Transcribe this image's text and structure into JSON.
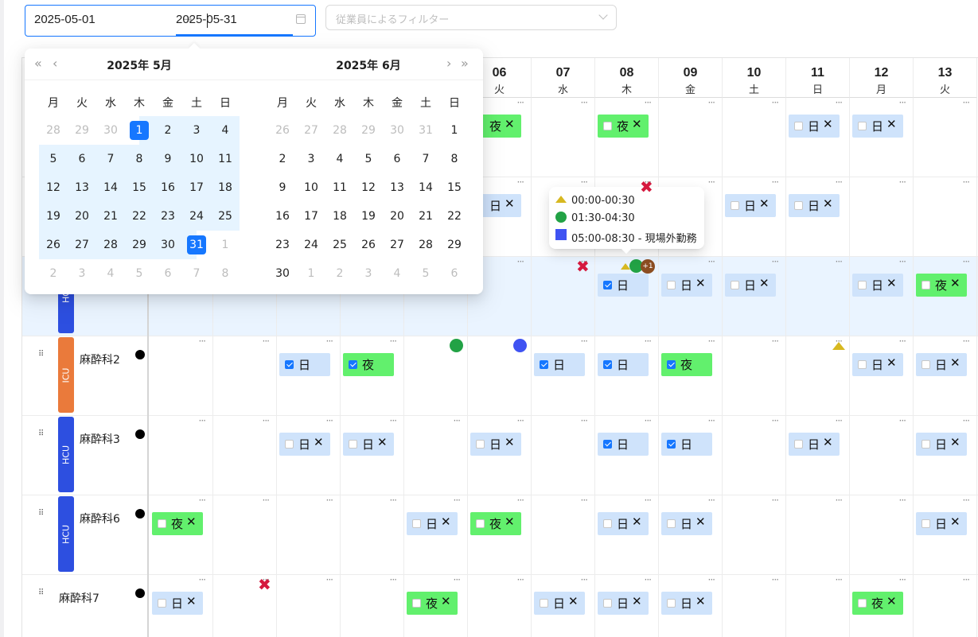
{
  "range_picker": {
    "start": "2025-05-01",
    "end": "2025-05-31",
    "separator": "→"
  },
  "filter": {
    "placeholder": "従業員によるフィルター"
  },
  "schedule": {
    "days": [
      {
        "day": "06",
        "wd": "火"
      },
      {
        "day": "07",
        "wd": "水"
      },
      {
        "day": "08",
        "wd": "木"
      },
      {
        "day": "09",
        "wd": "金"
      },
      {
        "day": "10",
        "wd": "土"
      },
      {
        "day": "11",
        "wd": "日"
      },
      {
        "day": "12",
        "wd": "月"
      },
      {
        "day": "13",
        "wd": "火"
      }
    ],
    "rows": [
      {
        "unit": "HCU",
        "name": "",
        "hl": true
      },
      {
        "unit": "ICU",
        "name": "麻酔科2"
      },
      {
        "unit": "HCU",
        "name": "麻酔科3"
      },
      {
        "unit": "HCU",
        "name": "麻酔科6"
      },
      {
        "unit": "",
        "name": "麻酔科7"
      }
    ],
    "chips": [
      {
        "row": -2,
        "col": 5,
        "t": "夜",
        "k": "n",
        "x": true
      },
      {
        "row": -2,
        "col": 7,
        "t": "夜",
        "k": "n",
        "x": true,
        "cb": "off"
      },
      {
        "row": -2,
        "col": 10,
        "t": "日",
        "k": "d",
        "x": true,
        "cb": "off"
      },
      {
        "row": -2,
        "col": 11,
        "t": "日",
        "k": "d",
        "x": true,
        "cb": "off"
      },
      {
        "row": -1,
        "col": 5,
        "t": "日",
        "k": "d",
        "x": true
      },
      {
        "row": -1,
        "col": 9,
        "t": "日",
        "k": "d",
        "x": true,
        "cb": "off"
      },
      {
        "row": -1,
        "col": 10,
        "t": "日",
        "k": "d",
        "x": true,
        "cb": "off"
      },
      {
        "row": 0,
        "col": 7,
        "t": "日",
        "k": "d",
        "x": false,
        "cb": "on"
      },
      {
        "row": 0,
        "col": 8,
        "t": "日",
        "k": "d",
        "x": true,
        "cb": "off"
      },
      {
        "row": 0,
        "col": 9,
        "t": "日",
        "k": "d",
        "x": true,
        "cb": "off"
      },
      {
        "row": 0,
        "col": 11,
        "t": "日",
        "k": "d",
        "x": true,
        "cb": "off"
      },
      {
        "row": 0,
        "col": 12,
        "t": "夜",
        "k": "n",
        "x": true,
        "cb": "off"
      },
      {
        "row": 1,
        "col": 2,
        "t": "日",
        "k": "d",
        "x": false,
        "cb": "on"
      },
      {
        "row": 1,
        "col": 3,
        "t": "夜",
        "k": "n",
        "x": false,
        "cb": "on"
      },
      {
        "row": 1,
        "col": 6,
        "t": "日",
        "k": "d",
        "x": false,
        "cb": "on"
      },
      {
        "row": 1,
        "col": 7,
        "t": "日",
        "k": "d",
        "x": false,
        "cb": "on"
      },
      {
        "row": 1,
        "col": 8,
        "t": "夜",
        "k": "n",
        "x": false,
        "cb": "on"
      },
      {
        "row": 1,
        "col": 11,
        "t": "日",
        "k": "d",
        "x": true,
        "cb": "off"
      },
      {
        "row": 1,
        "col": 12,
        "t": "日",
        "k": "d",
        "x": true,
        "cb": "off"
      },
      {
        "row": 2,
        "col": 2,
        "t": "日",
        "k": "d",
        "x": true,
        "cb": "off"
      },
      {
        "row": 2,
        "col": 3,
        "t": "日",
        "k": "d",
        "x": true,
        "cb": "off"
      },
      {
        "row": 2,
        "col": 5,
        "t": "日",
        "k": "d",
        "x": true,
        "cb": "off"
      },
      {
        "row": 2,
        "col": 7,
        "t": "日",
        "k": "d",
        "x": false,
        "cb": "on"
      },
      {
        "row": 2,
        "col": 8,
        "t": "日",
        "k": "d",
        "x": false,
        "cb": "on"
      },
      {
        "row": 2,
        "col": 10,
        "t": "日",
        "k": "d",
        "x": true,
        "cb": "off"
      },
      {
        "row": 2,
        "col": 12,
        "t": "日",
        "k": "d",
        "x": true,
        "cb": "off"
      },
      {
        "row": 3,
        "col": 0,
        "t": "夜",
        "k": "n",
        "x": true,
        "cb": "off"
      },
      {
        "row": 3,
        "col": 4,
        "t": "日",
        "k": "d",
        "x": true,
        "cb": "off"
      },
      {
        "row": 3,
        "col": 5,
        "t": "夜",
        "k": "n",
        "x": true,
        "cb": "off"
      },
      {
        "row": 3,
        "col": 7,
        "t": "日",
        "k": "d",
        "x": true,
        "cb": "off"
      },
      {
        "row": 3,
        "col": 8,
        "t": "日",
        "k": "d",
        "x": true,
        "cb": "off"
      },
      {
        "row": 3,
        "col": 12,
        "t": "日",
        "k": "d",
        "x": true,
        "cb": "off"
      },
      {
        "row": 4,
        "col": 0,
        "t": "日",
        "k": "d",
        "x": true,
        "cb": "off"
      },
      {
        "row": 4,
        "col": 4,
        "t": "夜",
        "k": "n",
        "x": true,
        "cb": "off"
      },
      {
        "row": 4,
        "col": 6,
        "t": "日",
        "k": "d",
        "x": true,
        "cb": "off"
      },
      {
        "row": 4,
        "col": 7,
        "t": "日",
        "k": "d",
        "x": true,
        "cb": "off"
      },
      {
        "row": 4,
        "col": 8,
        "t": "日",
        "k": "d",
        "x": true,
        "cb": "off"
      },
      {
        "row": 4,
        "col": 11,
        "t": "夜",
        "k": "n",
        "x": true,
        "cb": "off"
      }
    ],
    "chip_x_glyph": "✕",
    "plus_badge": "+1"
  },
  "calendar": {
    "weekdays": [
      "月",
      "火",
      "水",
      "木",
      "金",
      "土",
      "日"
    ],
    "left": {
      "title": "2025年  5月",
      "days": [
        [
          "28",
          "29",
          "30",
          "1",
          "2",
          "3",
          "4"
        ],
        [
          "5",
          "6",
          "7",
          "8",
          "9",
          "10",
          "11"
        ],
        [
          "12",
          "13",
          "14",
          "15",
          "16",
          "17",
          "18"
        ],
        [
          "19",
          "20",
          "21",
          "22",
          "23",
          "24",
          "25"
        ],
        [
          "26",
          "27",
          "28",
          "29",
          "30",
          "31",
          "1"
        ],
        [
          "2",
          "3",
          "4",
          "5",
          "6",
          "7",
          "8"
        ]
      ]
    },
    "right": {
      "title": "2025年  6月",
      "days": [
        [
          "26",
          "27",
          "28",
          "29",
          "30",
          "31",
          "1"
        ],
        [
          "2",
          "3",
          "4",
          "5",
          "6",
          "7",
          "8"
        ],
        [
          "9",
          "10",
          "11",
          "12",
          "13",
          "14",
          "15"
        ],
        [
          "16",
          "17",
          "18",
          "19",
          "20",
          "21",
          "22"
        ],
        [
          "23",
          "24",
          "25",
          "26",
          "27",
          "28",
          "29"
        ],
        [
          "30",
          "1",
          "2",
          "3",
          "4",
          "5",
          "6"
        ]
      ]
    },
    "nav": {
      "super_prev": "«",
      "prev": "‹",
      "next": "›",
      "super_next": "»"
    }
  },
  "tooltip": {
    "items": [
      {
        "icon": "triangle",
        "text": "00:00-00:30"
      },
      {
        "icon": "circle-green",
        "text": "01:30-04:30"
      },
      {
        "icon": "square-blue",
        "text": "05:00-08:30 - 現場外勤務"
      }
    ]
  }
}
